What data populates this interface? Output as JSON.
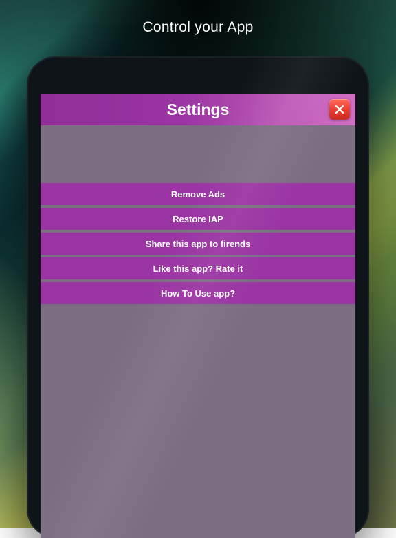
{
  "tagline": "Control your App",
  "titlebar": {
    "title": "Settings"
  },
  "menu": {
    "items": [
      {
        "label": "Remove Ads"
      },
      {
        "label": "Restore IAP"
      },
      {
        "label": "Share this app to firends"
      },
      {
        "label": "Like this app? Rate it"
      },
      {
        "label": "How To Use app?"
      }
    ]
  }
}
